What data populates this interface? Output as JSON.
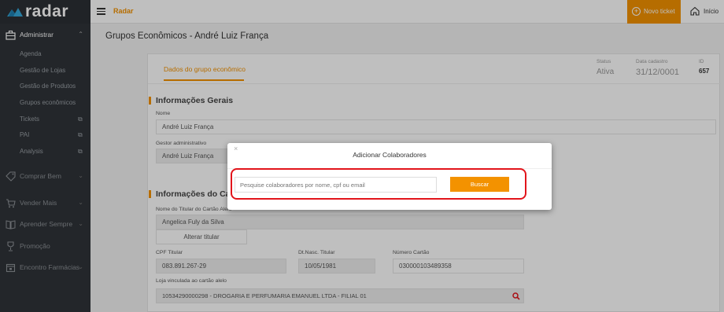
{
  "app": {
    "logo_text": "radar",
    "brand": "Radar"
  },
  "topbar": {
    "new_ticket": "Novo ticket",
    "home": "Início"
  },
  "sidebar": {
    "admin": {
      "label": "Administrar",
      "items": [
        "Agenda",
        "Gestão de Lojas",
        "Gestão de Produtos",
        "Grupos econômicos",
        "Tickets",
        "PAI",
        "Analysis"
      ]
    },
    "sections": [
      "Comprar Bem",
      "Vender Mais",
      "Aprender Sempre",
      "Promoção",
      "Encontro Farmácias"
    ]
  },
  "page": {
    "title": "Grupos Econômicos - André Luiz França",
    "tab": "Dados do grupo econômico",
    "meta": {
      "status_label": "Status",
      "status_value": "Ativa",
      "date_label": "Data cadastro",
      "date_value": "31/12/0001",
      "id_label": "ID",
      "id_value": "657"
    },
    "general": {
      "section": "Informações Gerais",
      "name_label": "Nome",
      "name_value": "André Luiz França",
      "manager_label": "Gestor administrativo",
      "manager_value": "André Luiz França"
    },
    "card_section": {
      "section": "Informações do Cartão",
      "holder_label": "Nome do Titular do Cartão Alelo",
      "holder_value": "Angelica Fuly da Silva",
      "change_button": "Alterar titular",
      "cpf_label": "CPF Titular",
      "cpf_value": "083.891.267-29",
      "birth_label": "Dt.Nasc. Titular",
      "birth_value": "10/05/1981",
      "cardnum_label": "Número Cartão",
      "cardnum_value": "030000103489358",
      "store_label": "Loja vinculada ao cartão alelo",
      "store_value": "10534290000298 -  DROGARIA E PERFUMARIA EMANUEL LTDA - FILIAL 01"
    }
  },
  "modal": {
    "close": "×",
    "title": "Adicionar Colaboradores",
    "search_placeholder": "Pesquise colaboradores por nome, cpf ou email",
    "search_button": "Buscar"
  },
  "colors": {
    "accent": "#f39200",
    "sidebar": "#2f3338",
    "highlight": "#e2141b"
  }
}
